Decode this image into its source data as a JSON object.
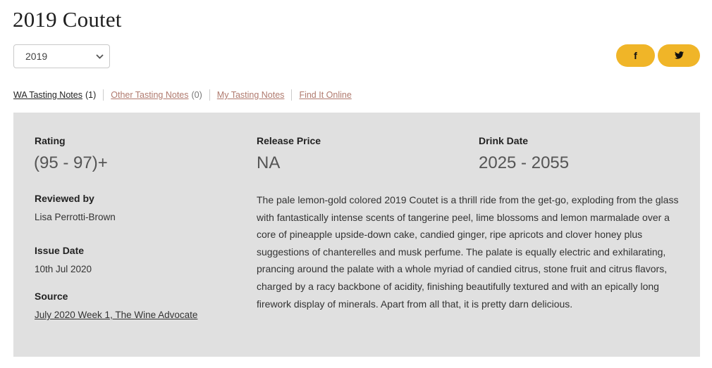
{
  "page": {
    "title": "2019 Coutet"
  },
  "vintage_select": {
    "value": "2019"
  },
  "share": {
    "facebook_label": "f",
    "twitter_label": "🐦"
  },
  "tabs": [
    {
      "label": "WA Tasting Notes",
      "count": "(1)",
      "active": true
    },
    {
      "label": "Other Tasting Notes",
      "count": "(0)",
      "active": false
    },
    {
      "label": "My Tasting Notes",
      "count": "",
      "active": false
    },
    {
      "label": "Find It Online",
      "count": "",
      "active": false
    }
  ],
  "review": {
    "rating_label": "Rating",
    "rating_value": "(95 - 97)+",
    "release_price_label": "Release Price",
    "release_price_value": "NA",
    "drink_date_label": "Drink Date",
    "drink_date_value": "2025 - 2055",
    "reviewed_by_label": "Reviewed by",
    "reviewer": "Lisa Perrotti-Brown",
    "issue_date_label": "Issue Date",
    "issue_date": "10th Jul 2020",
    "source_label": "Source",
    "source": "July 2020 Week 1, The Wine Advocate",
    "tasting_note": "The pale lemon-gold colored 2019 Coutet is a thrill ride from the get-go, exploding from the glass with fantastically intense scents of tangerine peel, lime blossoms and lemon marmalade over a core of pineapple upside-down cake, candied ginger, ripe apricots and clover honey plus suggestions of chanterelles and musk perfume. The palate is equally electric and exhilarating, prancing around the palate with a whole myriad of candied citrus, stone fruit and citrus flavors, charged by a racy backbone of acidity, finishing beautifully textured and with an epically long firework display of minerals. Apart from all that, it is pretty darn delicious."
  },
  "colors": {
    "accent": "#f0b528",
    "panel": "#e0e0e0",
    "tab_link": "#b07a6e"
  }
}
